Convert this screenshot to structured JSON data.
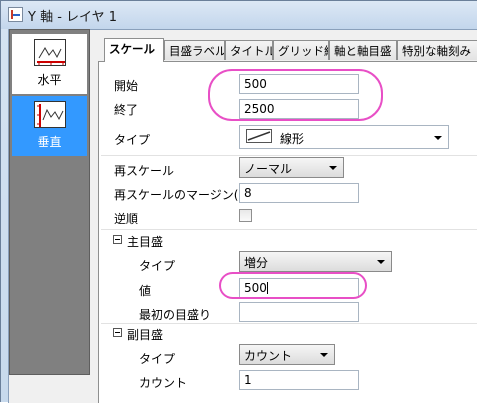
{
  "window": {
    "title": "Y 軸 - レイヤ 1"
  },
  "sidebar": {
    "items": [
      {
        "label": "水平",
        "selected": false
      },
      {
        "label": "垂直",
        "selected": true
      }
    ]
  },
  "tabs": [
    {
      "label": "スケール",
      "active": true
    },
    {
      "label": "目盛ラベル"
    },
    {
      "label": "タイトル"
    },
    {
      "label": "グリッド線"
    },
    {
      "label": "軸と軸目盛"
    },
    {
      "label": "特別な軸刻み"
    }
  ],
  "scale": {
    "from_label": "開始",
    "from_value": "500",
    "to_label": "終了",
    "to_value": "2500",
    "type_label": "タイプ",
    "type_value": "線形",
    "type_icon": "linear-scale-icon",
    "rescale_label": "再スケール",
    "rescale_value": "ノーマル",
    "rescale_margin_label": "再スケールのマージン(%)",
    "rescale_margin_value": "8",
    "reverse_label": "逆順",
    "reverse_checked": false
  },
  "major_ticks": {
    "header": "主目盛",
    "type_label": "タイプ",
    "type_value": "増分",
    "value_label": "値",
    "value": "500",
    "first_tick_label": "最初の目盛り",
    "first_tick_value": ""
  },
  "minor_ticks": {
    "header": "副目盛",
    "type_label": "タイプ",
    "type_value": "カウント",
    "count_label": "カウント",
    "count_value": "1"
  },
  "colors": {
    "selection": "#3399ff",
    "highlight": "#e84fc6",
    "panel": "#808080"
  }
}
